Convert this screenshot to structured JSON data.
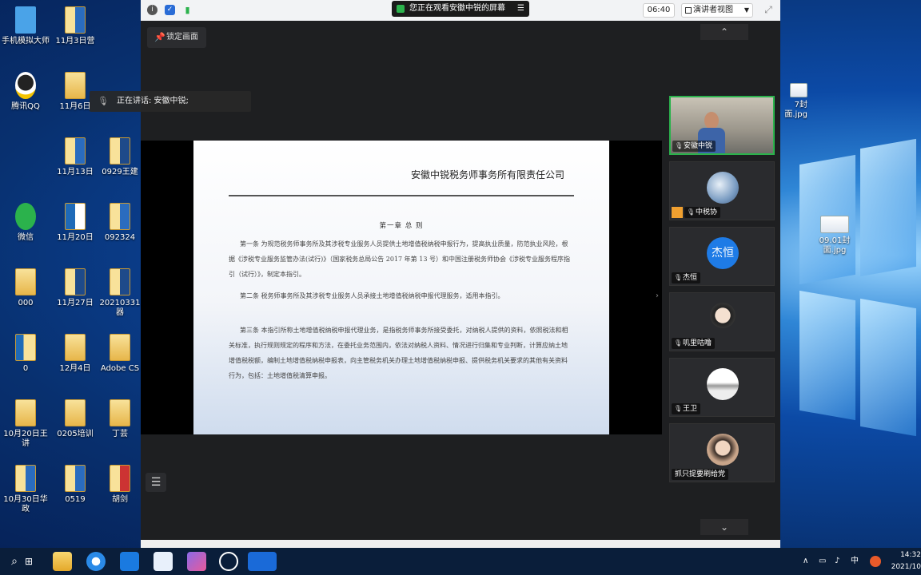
{
  "desktop": {
    "icons_left": [
      {
        "label": "手机模拟大师"
      },
      {
        "label": "腾讯QQ"
      },
      {
        "label": "微信"
      },
      {
        "label": "000"
      },
      {
        "label": "0"
      },
      {
        "label": "10月20日王讲"
      },
      {
        "label": "10月30日华政"
      }
    ],
    "icons_mid": [
      {
        "label": "11月3日营"
      },
      {
        "label": "11月6日"
      },
      {
        "label": "11月13日"
      },
      {
        "label": "11月20日"
      },
      {
        "label": "11月27日"
      },
      {
        "label": "12月4日"
      },
      {
        "label": "0205培训"
      },
      {
        "label": "0519"
      }
    ],
    "icons_right": [
      {
        "label": "0929王建"
      },
      {
        "label": "092324"
      },
      {
        "label": "20210331 器"
      },
      {
        "label": "Adobe CS"
      },
      {
        "label": "丁芸"
      },
      {
        "label": "胡剑"
      }
    ],
    "icons_far_right": [
      {
        "label": "7封面.jpg"
      },
      {
        "label": "09.01封面.jpg"
      }
    ]
  },
  "meeting": {
    "share_banner": "您正在观看安徽中锐的屏幕",
    "timer": "06:40",
    "view_mode": "演讲者视图",
    "pin_label": "锁定画面",
    "speaking_label": "正在讲话: 安徽中锐;",
    "participants": [
      {
        "name": "安徽中锐",
        "active": true
      },
      {
        "name": "中税协",
        "active": false
      },
      {
        "name": "杰恒",
        "active": false,
        "initials": "杰恒"
      },
      {
        "name": "叽里咕噜",
        "active": false
      },
      {
        "name": "王卫",
        "active": false
      },
      {
        "name": "抓只提要刷给党",
        "active": false
      }
    ]
  },
  "slide": {
    "company": "安徽中锐税务师事务所有限责任公司",
    "chapter": "第一章  总  则",
    "paragraphs": [
      "第一条 为规范税务师事务所及其涉税专业服务人员提供土地增值税纳税申报行为，提高执业质量，防范执业风险，根据《涉税专业服务监管办法(试行)》（国家税务总局公告 2017 年第 13 号）和中国注册税务师协会《涉税专业服务程序指引（试行）》，制定本指引。",
      "第二条 税务师事务所及其涉税专业服务人员承接土地增值税纳税申报代理服务，适用本指引。",
      "第三条 本指引所称土地增值税纳税申报代理业务，是指税务师事务所接受委托，对纳税人提供的资料，依照税法和相关标准，执行规则规定的程序和方法，在委托业务范围内，依法对纳税人资料、情况进行归集和专业判断，计算应纳土地增值税税额，编制土地增值税纳税申报表，向主管税务机关办理土地增值税纳税申报、提供税务机关要求的其他有关资料行为，包括：土地增值税清算申报。"
    ]
  },
  "taskbar": {
    "ime": "中",
    "time": "14:32",
    "date": "2021/10"
  },
  "colors": {
    "accent_green": "#2bb24c",
    "avatar_blue": "#1e7be6"
  }
}
